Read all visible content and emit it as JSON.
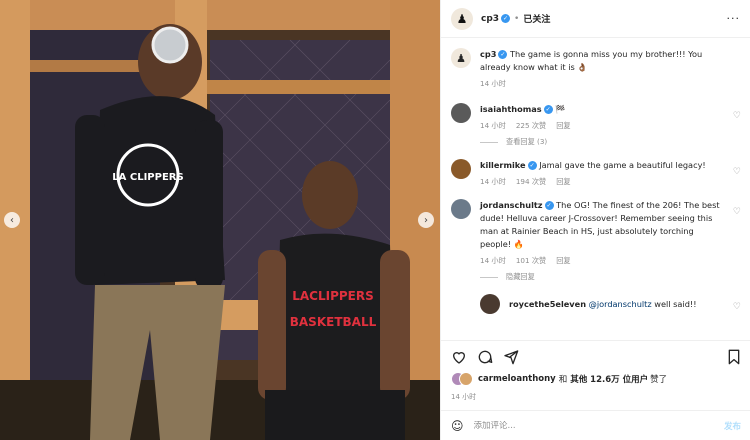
{
  "header": {
    "username": "cp3",
    "separator": "•",
    "follow_label": "已关注",
    "more_icon": "more-horizontal-icon"
  },
  "comments": [
    {
      "username": "cp3",
      "text": "The game is gonna miss you my brother!!! You already know what it is",
      "emoji": "👌🏾",
      "time": "14 小时",
      "avatar_color": "#f0e8dc"
    },
    {
      "username": "isaiahthomas",
      "text": "",
      "emoji": "🏁",
      "time": "14 小时",
      "likes": "225 次赞",
      "reply": "回复",
      "avatar_color": "#5a5a5a",
      "view_replies": "查看回复 (3)"
    },
    {
      "username": "killermike",
      "text": "Jamal gave the game a beautiful legacy!",
      "time": "14 小时",
      "likes": "194 次赞",
      "reply": "回复",
      "avatar_color": "#8a5a2a"
    },
    {
      "username": "jordanschultz",
      "text": "The OG! The finest of the 206! The best dude! Helluva career J-Crossover! Remember seeing this man at Rainier Beach in HS, just absolutely torching people!",
      "emoji": "🔥",
      "time": "14 小时",
      "likes": "101 次赞",
      "reply": "回复",
      "avatar_color": "#6b7a8a",
      "hide_replies": "隐藏回复"
    },
    {
      "username": "roycethe5eleven",
      "mention": "@jordanschultz",
      "text": "well said!!",
      "avatar_color": "#4a3a30"
    }
  ],
  "actions": {
    "like_icon": "heart-icon",
    "comment_icon": "comment-icon",
    "share_icon": "send-icon",
    "save_icon": "bookmark-icon"
  },
  "likes": {
    "user": "carmeloanthony",
    "conj": "和",
    "others": "其他 12.6万 位用户",
    "suffix": "赞了"
  },
  "post_time": "14 小时",
  "add_comment": {
    "placeholder": "添加评论...",
    "post_label": "发布",
    "emoji_icon": "smile-icon"
  },
  "photo": {
    "jersey_line1": "LACLIPPERS",
    "jersey_line2": "BASKETBALL",
    "shirt_logo": "LA CLIPPERS"
  },
  "colors": {
    "verified": "#3897f0",
    "link": "#00376b",
    "post_button": "#b2dffc"
  }
}
